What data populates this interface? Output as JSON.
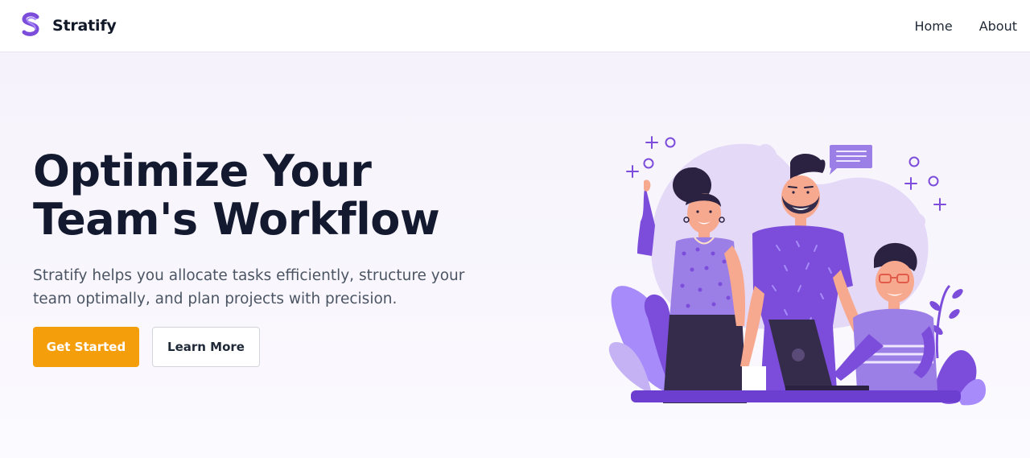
{
  "nav": {
    "brand": "Stratify",
    "links": [
      "Home",
      "About"
    ]
  },
  "hero": {
    "title_line1": "Optimize Your",
    "title_line2": "Team's Workflow",
    "subtitle": "Stratify helps you allocate tasks efficiently, structure your team optimally, and plan projects with precision.",
    "primary_cta": "Get Started",
    "secondary_cta": "Learn More"
  },
  "colors": {
    "brand_purple": "#7c4ddb",
    "cta_orange": "#f59e0b",
    "heading": "#131a2f"
  },
  "icons": [
    "stratify-logo-icon",
    "team-illustration"
  ]
}
